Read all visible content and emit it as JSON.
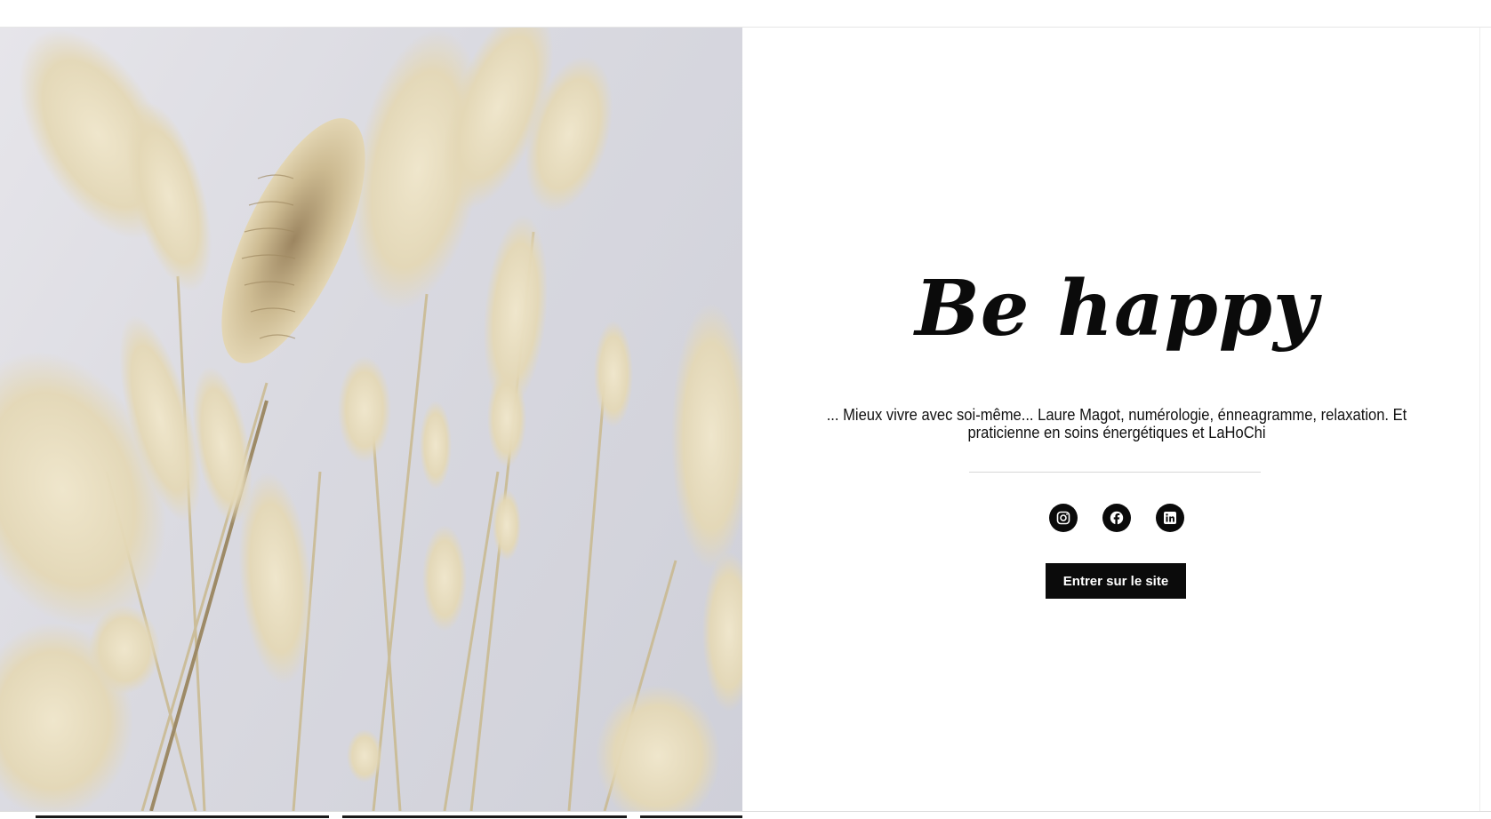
{
  "hero": {
    "title": "Be happy",
    "tagline": "... Mieux vivre avec soi-même... Laure Magot, numérologie, énneagramme, relaxation. Et praticienne en soins énergétiques et LaHoChi"
  },
  "socials": [
    {
      "name": "instagram",
      "icon": "instagram-icon"
    },
    {
      "name": "facebook",
      "icon": "facebook-icon"
    },
    {
      "name": "linkedin",
      "icon": "linkedin-icon"
    }
  ],
  "cta": {
    "label": "Entrer sur le site"
  },
  "colors": {
    "text": "#0b0b0b",
    "button_bg": "#0b0b0b",
    "button_text": "#ffffff",
    "photo_bg": "#d9d9e0",
    "grass": "#e9dfc4"
  }
}
